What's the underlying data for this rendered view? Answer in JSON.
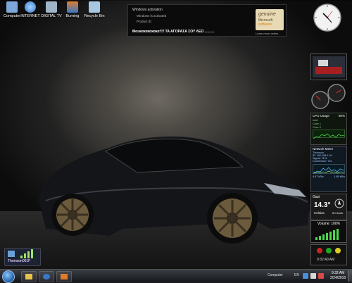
{
  "desktop_icons": [
    {
      "label": "Computer",
      "icon": "computer-icon",
      "color": "#7da7d9"
    },
    {
      "label": "INTERNET",
      "icon": "browser-icon",
      "color": "#3a78c9"
    },
    {
      "label": "DIGITAL TV",
      "icon": "tv-icon",
      "color": "#9fb4c7"
    },
    {
      "label": "Burning",
      "icon": "burning-icon",
      "color": "#e07b2a"
    },
    {
      "label": "Recycle Bin",
      "icon": "recycle-bin-icon",
      "color": "#a8c7e0"
    }
  ],
  "activation": {
    "title": "Windows activation",
    "line1": "Windows is activated",
    "line2": "Product ID",
    "message": "Μουκακακακακα!!!! ΤΑ ΑΓΟΡΑΣΑ ΣΟΥ ΛΕΩ ..........",
    "genuine_top": "genuine",
    "genuine_mid": "Microsoft",
    "genuine_bot": "software",
    "learn_more": "Learn more online..."
  },
  "cpu_gadget": {
    "title": "CPU Usage",
    "percent": "60%",
    "rows": [
      "Intel",
      "Core 1",
      "Core 2"
    ]
  },
  "network_gadget": {
    "title": "Network Meter",
    "rows": [
      "Thomson",
      "IP: 192.168.1.64",
      "Signal: 71%",
      "Connection: Yes"
    ],
    "footer_left": "4.87 kB/s",
    "footer_right": "1.65 kB/s"
  },
  "weather_gadget": {
    "city": "Gazi",
    "temperature": "14.3°",
    "unit": "Celsius",
    "wind": "5.0 km/h"
  },
  "volume_gadget": {
    "label": "Volume: 100%",
    "level": 1.0
  },
  "alarm_gadget": {
    "time": "9:32:40 AM"
  },
  "thomson_icon": {
    "label": "Thomson001F"
  },
  "taskbar": {
    "buttons": [
      {
        "icon": "explorer-icon",
        "color": "#e8c24a"
      },
      {
        "icon": "media-player-icon",
        "color": "#3a78c9"
      },
      {
        "icon": "media-center-icon",
        "color": "#e07b2a"
      }
    ],
    "tray_label": "Computer",
    "language": "EN",
    "clock_time": "9:32 AM",
    "clock_date": "2/24/2010"
  }
}
